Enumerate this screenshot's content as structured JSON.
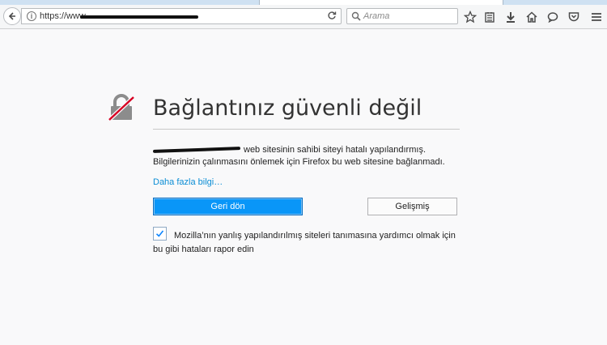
{
  "browser": {
    "url_prefix": "https://www",
    "search_placeholder": "Arama",
    "toolbar_icons": [
      "star-icon",
      "reading-list-icon",
      "download-icon",
      "home-icon",
      "chat-icon",
      "pocket-icon",
      "menu-icon"
    ]
  },
  "error_page": {
    "title": "Bağlantınız güvenli değil",
    "description_line1_suffix": "web sitesinin sahibi siteyi hatalı yapılandırmış.",
    "description_line2": "Bilgilerinizin çalınmasını önlemek için Firefox bu web sitesine bağlanmadı.",
    "more_info_link": "Daha fazla bilgi…",
    "go_back_button": "Geri dön",
    "advanced_button": "Gelişmiş",
    "report_checked": true,
    "report_text": "Mozilla’nın yanlış yapılandırılmış siteleri tanımasına yardımcı olmak için bu gibi hataları rapor edin"
  },
  "colors": {
    "primary_button": "#0996f8",
    "link": "#0a8dd5",
    "icon_slash": "#d70022",
    "icon_lock": "#737373"
  }
}
